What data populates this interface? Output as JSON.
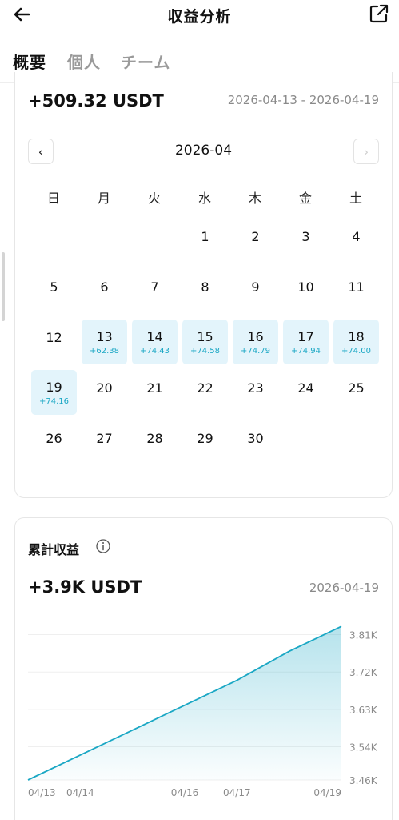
{
  "header": {
    "title": "収益分析",
    "back_icon": "arrow-left-icon",
    "share_icon": "external-link-icon"
  },
  "tabs": [
    {
      "label": "概要",
      "active": true
    },
    {
      "label": "個人",
      "active": false
    },
    {
      "label": "チーム",
      "active": false
    }
  ],
  "period_card": {
    "amount": "+509.32 USDT",
    "date_range": "2026-04-13 - 2026-04-19",
    "month_label": "2026-04",
    "prev_label": "‹",
    "next_label": "›",
    "weekdays": [
      "日",
      "月",
      "火",
      "水",
      "木",
      "金",
      "土"
    ],
    "days": [
      {
        "day": "1",
        "earn": ""
      },
      {
        "day": "2",
        "earn": ""
      },
      {
        "day": "3",
        "earn": ""
      },
      {
        "day": "4",
        "earn": ""
      },
      {
        "day": "5",
        "earn": ""
      },
      {
        "day": "6",
        "earn": ""
      },
      {
        "day": "7",
        "earn": ""
      },
      {
        "day": "8",
        "earn": ""
      },
      {
        "day": "9",
        "earn": ""
      },
      {
        "day": "10",
        "earn": ""
      },
      {
        "day": "11",
        "earn": ""
      },
      {
        "day": "12",
        "earn": ""
      },
      {
        "day": "13",
        "earn": "+62.38"
      },
      {
        "day": "14",
        "earn": "+74.43"
      },
      {
        "day": "15",
        "earn": "+74.58"
      },
      {
        "day": "16",
        "earn": "+74.79"
      },
      {
        "day": "17",
        "earn": "+74.94"
      },
      {
        "day": "18",
        "earn": "+74.00"
      },
      {
        "day": "19",
        "earn": "+74.16"
      },
      {
        "day": "20",
        "earn": ""
      },
      {
        "day": "21",
        "earn": ""
      },
      {
        "day": "22",
        "earn": ""
      },
      {
        "day": "23",
        "earn": ""
      },
      {
        "day": "24",
        "earn": ""
      },
      {
        "day": "25",
        "earn": ""
      },
      {
        "day": "26",
        "earn": ""
      },
      {
        "day": "27",
        "earn": ""
      },
      {
        "day": "28",
        "earn": ""
      },
      {
        "day": "29",
        "earn": ""
      },
      {
        "day": "30",
        "earn": ""
      }
    ]
  },
  "cumulative_card": {
    "title": "累計収益",
    "info_icon": "info-circle-icon",
    "amount": "+3.9K USDT",
    "date": "2026-04-19"
  },
  "colors": {
    "accent": "#1aa7c4",
    "highlight_bg": "#e3f4fb"
  },
  "chart_data": {
    "type": "area",
    "x": [
      "04/13",
      "04/14",
      "04/15",
      "04/16",
      "04/17",
      "04/18",
      "04/19"
    ],
    "values": [
      3.46,
      3.52,
      3.58,
      3.64,
      3.7,
      3.77,
      3.83
    ],
    "x_tick_labels": [
      "04/13",
      "04/14",
      "04/16",
      "04/17",
      "04/19"
    ],
    "y_tick_labels": [
      "3.81K",
      "3.72K",
      "3.63K",
      "3.54K",
      "3.46K"
    ],
    "y_ticks": [
      3.81,
      3.72,
      3.63,
      3.54,
      3.46
    ],
    "ylim": [
      3.46,
      3.84
    ],
    "grid": true,
    "line_color": "#1aa7c4"
  }
}
